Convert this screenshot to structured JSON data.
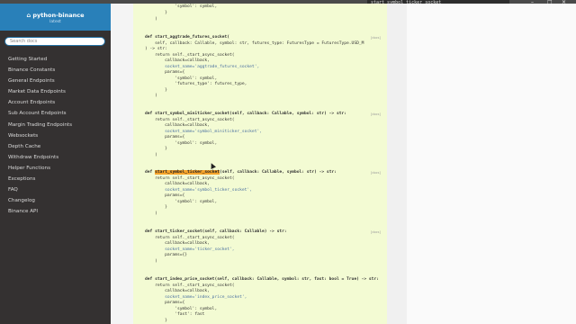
{
  "browser": {
    "find_text": "start_symbol_ticker_socket",
    "controls": [
      "–",
      "□",
      "×"
    ]
  },
  "sidebar": {
    "project_name": "python-binance",
    "project_icon": "home-icon",
    "version": "latest",
    "search_placeholder": "Search docs",
    "items": [
      {
        "label": "Getting Started"
      },
      {
        "label": "Binance Constants"
      },
      {
        "label": "General Endpoints"
      },
      {
        "label": "Market Data Endpoints"
      },
      {
        "label": "Account Endpoints"
      },
      {
        "label": "Sub Account Endpoints"
      },
      {
        "label": "Margin Trading Endpoints"
      },
      {
        "label": "Websockets"
      },
      {
        "label": "Depth Cache"
      },
      {
        "label": "Withdraw Endpoints"
      },
      {
        "label": "Helper Functions"
      },
      {
        "label": "Exceptions"
      },
      {
        "label": "FAQ"
      },
      {
        "label": "Changelog"
      },
      {
        "label": "Binance API"
      }
    ]
  },
  "code": {
    "source_link": "[docs]",
    "top": [
      "            'symbol': symbol,",
      "        }",
      "    )"
    ],
    "aggtrade_futures": {
      "sig": "def start_aggtrade_futures_socket(",
      "lines": [
        "    self, callback: Callable, symbol: str, futures_type: FuturesType = FuturesType.USD_M",
        ") -> str:",
        "    return self._start_async_socket(",
        "        callback=callback,",
        "        socket_name='aggtrade_futures_socket',",
        "        params={",
        "            'symbol': symbol,",
        "            'futures_type': futures_type,",
        "        }",
        "    )"
      ]
    },
    "miniticker": {
      "sig": "def start_symbol_miniticker_socket(self, callback: Callable, symbol: str) -> str:",
      "lines": [
        "    return self._start_async_socket(",
        "        callback=callback,",
        "        socket_name='symbol_miniticker_socket',",
        "        params={",
        "            'symbol': symbol,",
        "        }",
        "    )"
      ]
    },
    "ticker_symbol": {
      "def_kw": "def ",
      "name": "start_symbol_ticker_socket",
      "rest": "(self, callback: Callable, symbol: str) -> str:",
      "lines": [
        "    return self._start_async_socket(",
        "        callback=callback,",
        "        socket_name='symbol_ticker_socket',",
        "        params={",
        "            'symbol': symbol,",
        "        }",
        "    )"
      ]
    },
    "ticker": {
      "sig": "def start_ticker_socket(self, callback: Callable) -> str:",
      "lines": [
        "    return self._start_async_socket(",
        "        callback=callback,",
        "        socket_name='ticker_socket',",
        "        params={}",
        "    )"
      ]
    },
    "index_price": {
      "sig": "def start_index_price_socket(self, callback: Callable, symbol: str, fast: bool = True) -> str:",
      "lines": [
        "    return self._start_async_socket(",
        "        callback=callback,",
        "        socket_name='index_price_socket',",
        "        params={",
        "            'symbol': symbol,",
        "            'fast': fast",
        "        }"
      ]
    }
  }
}
